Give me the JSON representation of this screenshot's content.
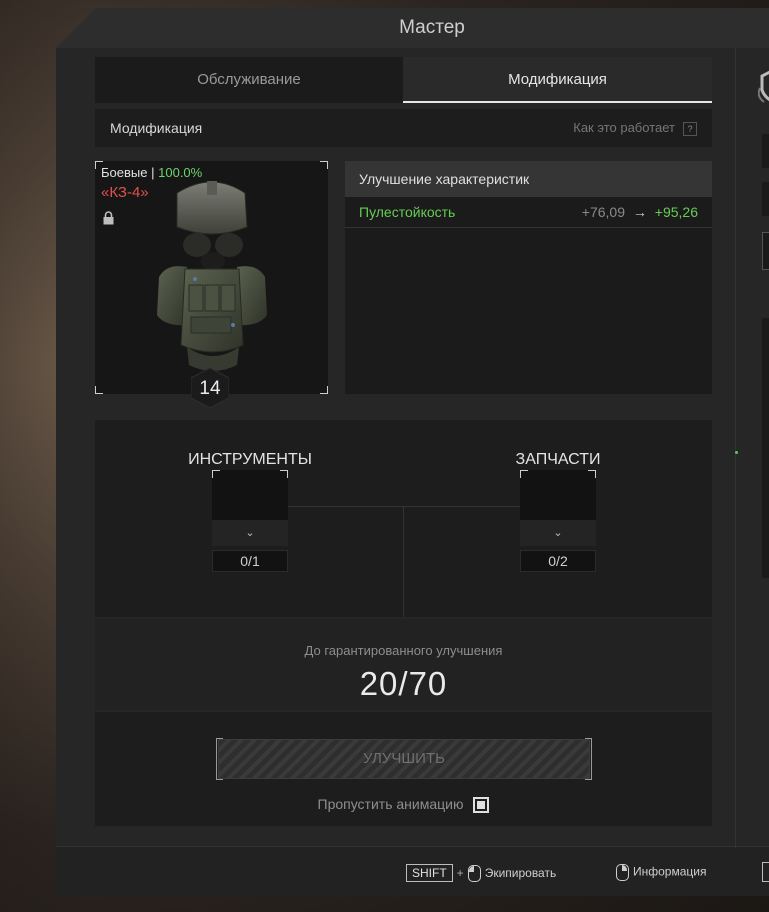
{
  "window": {
    "title": "Мастер"
  },
  "tabs": [
    {
      "label": "Обслуживание",
      "active": false
    },
    {
      "label": "Модификация",
      "active": true
    }
  ],
  "modification": {
    "header": "Модификация",
    "how_it_works": "Как это работает",
    "help_icon": "?"
  },
  "item": {
    "condition_label": "Боевые",
    "separator": "|",
    "condition_value": "100.0%",
    "name": "«КЗ-4»",
    "level": "14",
    "icons": [
      "lock-icon",
      "armor-image"
    ]
  },
  "stats": {
    "title": "Улучшение характеристик",
    "rows": [
      {
        "name": "Пулестойкость",
        "current": "+76,09",
        "arrow": "→",
        "new": "+95,26"
      }
    ]
  },
  "materials": {
    "tools": {
      "label": "ИНСТРУМЕНТЫ",
      "count": "0/1"
    },
    "parts": {
      "label": "ЗАПЧАСТИ",
      "count": "0/2"
    }
  },
  "guarantee": {
    "label": "До гарантированного улучшения",
    "value": "20/70"
  },
  "upgrade": {
    "button_label": "УЛУЧШИТЬ",
    "skip_label": "Пропустить анимацию",
    "skip_checked": true
  },
  "footer": {
    "shift_key": "SHIFT",
    "plus": "+",
    "equip_label": "Экипировать",
    "info_label": "Информация"
  },
  "colors": {
    "accent_green": "#66cc55",
    "name_red": "#e05050",
    "panel_bg": "#262626"
  }
}
